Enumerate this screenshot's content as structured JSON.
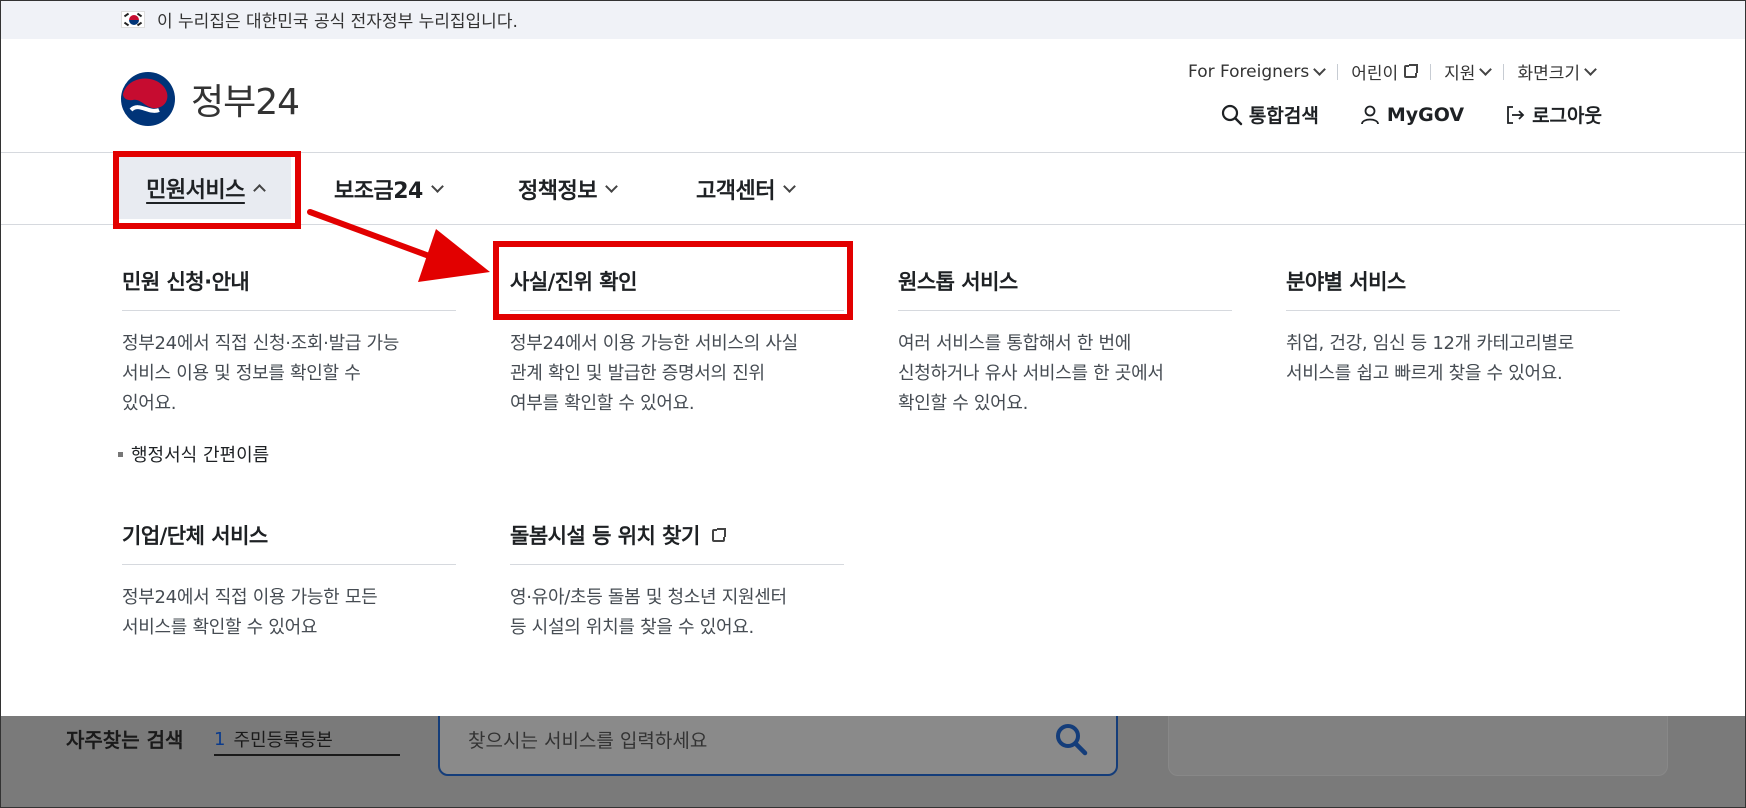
{
  "gov_banner": {
    "text": "이 누리집은 대한민국 공식 전자정부 누리집입니다."
  },
  "logo": {
    "text": "정부24"
  },
  "util_menu": {
    "foreigners": "For Foreigners",
    "kids": "어린이",
    "support": "지원",
    "zoom": "화면크기"
  },
  "quick": {
    "search": "통합검색",
    "mygov": "MyGOV",
    "logout": "로그아웃"
  },
  "nav": {
    "items": [
      {
        "label": "민원서비스"
      },
      {
        "label": "보조금24"
      },
      {
        "label": "정책정보"
      },
      {
        "label": "고객센터"
      }
    ]
  },
  "panel": {
    "c1": {
      "title": "민원 신청·안내",
      "desc": [
        "정부24에서 직접 신청·조회·발급 가능",
        "서비스 이용 및 정보를 확인할 수",
        "있어요."
      ],
      "sub": "행정서식 간편이름"
    },
    "c2": {
      "title": "사실/진위 확인",
      "desc": [
        "정부24에서 이용 가능한 서비스의 사실",
        "관계 확인 및 발급한 증명서의 진위",
        "여부를 확인할 수 있어요."
      ]
    },
    "c3": {
      "title": "원스톱 서비스",
      "desc": [
        "여러 서비스를 통합해서 한 번에",
        "신청하거나 유사 서비스를 한 곳에서",
        "확인할 수 있어요."
      ]
    },
    "c4": {
      "title": "분야별 서비스",
      "desc": [
        "취업, 건강, 임신 등 12개 카테고리별로",
        "서비스를 쉽고 빠르게 찾을 수 있어요."
      ]
    },
    "c5": {
      "title": "기업/단체 서비스",
      "desc": [
        "정부24에서 직접 이용 가능한 모든",
        "서비스를 확인할 수 있어요"
      ]
    },
    "c6": {
      "title": "돌봄시설 등 위치 찾기",
      "desc": [
        "영·유아/초등 돌봄 및 청소년 지원센터",
        "등 시설의 위치를 찾을 수 있어요."
      ]
    }
  },
  "background": {
    "popular_label": "자주찾는 검색",
    "popular_rank": "1",
    "popular_value": "주민등록등본",
    "search_placeholder": "찾으시는 서비스를 입력하세요"
  },
  "colors": {
    "highlight": "#e20000",
    "brand_blue": "#003478",
    "brand_red": "#c60c30"
  }
}
